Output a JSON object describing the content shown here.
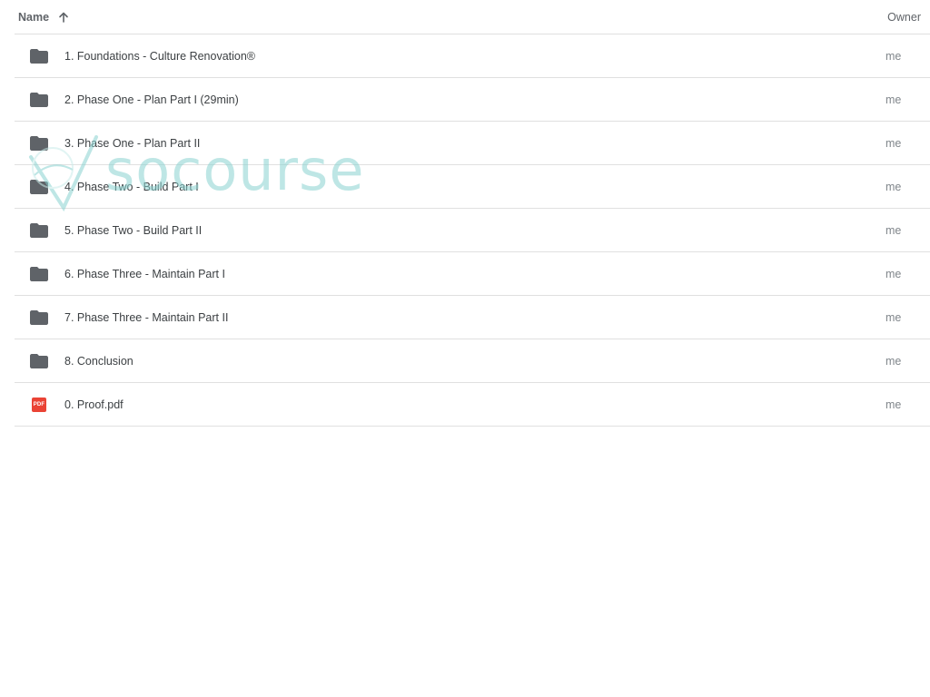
{
  "columns": {
    "name": "Name",
    "owner": "Owner"
  },
  "icons": {
    "folder": "folder-icon",
    "pdf": "pdf-icon",
    "sort": "arrow-up-icon",
    "watermark": "watermark-logo-icon"
  },
  "colors": {
    "folder": "#5f6368",
    "pdf": "#ea4335",
    "watermark": "#8ad3d0"
  },
  "rows": [
    {
      "name": "1. Foundations - Culture Renovation®",
      "owner": "me",
      "type": "folder"
    },
    {
      "name": "2. Phase One - Plan Part I (29min)",
      "owner": "me",
      "type": "folder"
    },
    {
      "name": "3. Phase One - Plan Part II",
      "owner": "me",
      "type": "folder"
    },
    {
      "name": "4. Phase Two - Build Part I",
      "owner": "me",
      "type": "folder"
    },
    {
      "name": "5. Phase Two - Build Part II",
      "owner": "me",
      "type": "folder"
    },
    {
      "name": "6. Phase Three - Maintain Part I",
      "owner": "me",
      "type": "folder"
    },
    {
      "name": "7. Phase Three - Maintain Part II",
      "owner": "me",
      "type": "folder"
    },
    {
      "name": "8. Conclusion",
      "owner": "me",
      "type": "folder"
    },
    {
      "name": "0. Proof.pdf",
      "owner": "me",
      "type": "pdf"
    }
  ],
  "pdf_badge": "PDF",
  "watermark": "socourse"
}
